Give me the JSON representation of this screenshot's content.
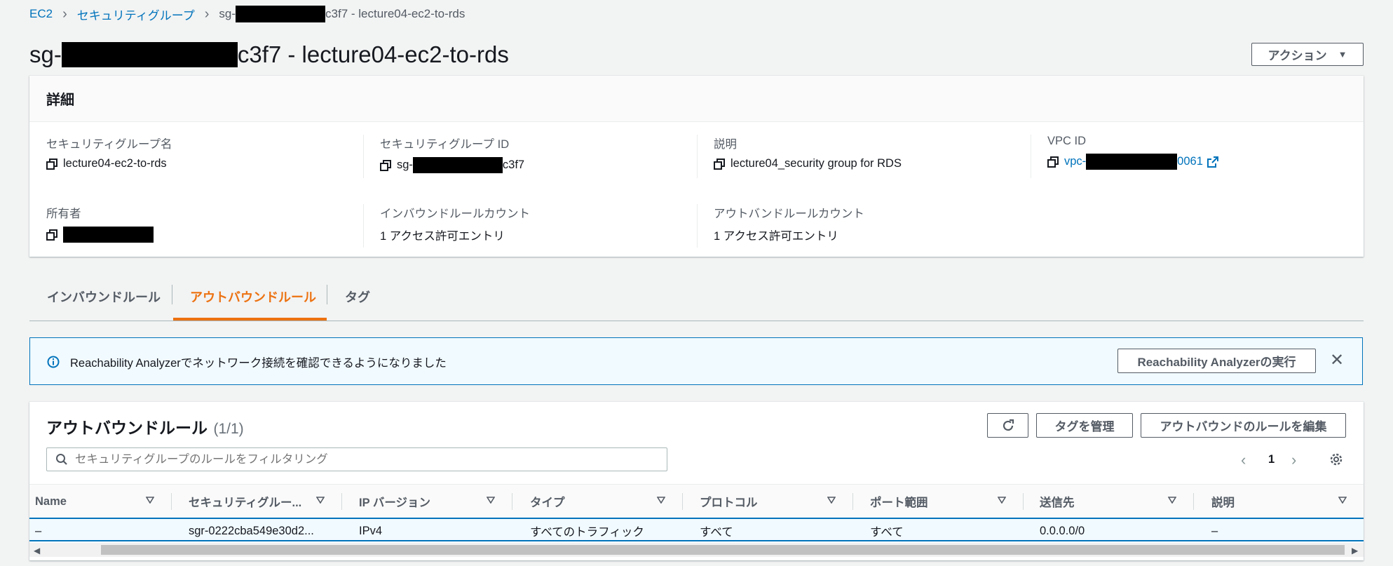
{
  "breadcrumb": {
    "items": [
      "EC2",
      "セキュリティグループ"
    ],
    "current_prefix": "sg-",
    "current_suffix": "c3f7 - lecture04-ec2-to-rds"
  },
  "title": {
    "prefix": "sg-",
    "suffix": "c3f7 - lecture04-ec2-to-rds"
  },
  "actions_button": {
    "label": "アクション"
  },
  "details": {
    "heading": "詳細",
    "fields": {
      "sg_name": {
        "label": "セキュリティグループ名",
        "value": "lecture04-ec2-to-rds"
      },
      "sg_id": {
        "label": "セキュリティグループ ID",
        "value_prefix": "sg-",
        "value_suffix": "c3f7"
      },
      "description": {
        "label": "説明",
        "value": "lecture04_security group for RDS"
      },
      "vpc_id": {
        "label": "VPC ID",
        "value_prefix": "vpc-",
        "value_suffix": "0061"
      },
      "owner": {
        "label": "所有者"
      },
      "inbound_count": {
        "label": "インバウンドルールカウント",
        "value": "1 アクセス許可エントリ"
      },
      "outbound_count": {
        "label": "アウトバンドルールカウント",
        "value": "1 アクセス許可エントリ"
      }
    }
  },
  "tabs": [
    {
      "label": "インバウンドルール",
      "active": false
    },
    {
      "label": "アウトバウンドルール",
      "active": true
    },
    {
      "label": "タグ",
      "active": false
    }
  ],
  "alert": {
    "message": "Reachability Analyzerでネットワーク接続を確認できるようになりました",
    "button_label": "Reachability Analyzerの実行"
  },
  "rules": {
    "title": "アウトバウンドルール",
    "count": "(1/1)",
    "manage_tags_label": "タグを管理",
    "edit_rules_label": "アウトバウンドのルールを編集",
    "filter_placeholder": "セキュリティグループのルールをフィルタリング",
    "page": "1",
    "columns": [
      "Name",
      "セキュリティグルー...",
      "IP バージョン",
      "タイプ",
      "プロトコル",
      "ポート範囲",
      "送信先",
      "説明"
    ],
    "rows": [
      [
        "–",
        "sgr-0222cba549e30d2...",
        "IPv4",
        "すべてのトラフィック",
        "すべて",
        "すべて",
        "0.0.0.0/0",
        "–"
      ]
    ]
  },
  "colors": {
    "link": "#0073bb",
    "accent_tab": "#ec7211",
    "info_bg": "#f1faff",
    "selected_row_bg": "#f1faff"
  }
}
